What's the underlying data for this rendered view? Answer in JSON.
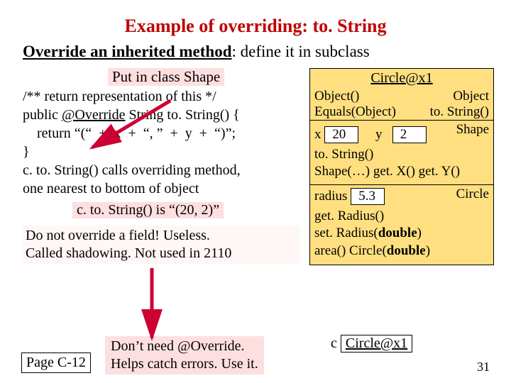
{
  "title": "Example of overriding: to. String",
  "subtitle_bold": "Override an inherited method",
  "subtitle_rest": ": define it in subclass",
  "putin": "Put in class Shape",
  "code": {
    "l1": "/** return representation of this */",
    "l2a": "public",
    "l2b": "@Override",
    "l2c": " String to. String() {",
    "l3": "    return “(“  +  x  +  “, ”  +  y  +  “)”;",
    "l4": "}",
    "l5": "c. to. String() calls overriding method,",
    "l6": "one nearest to bottom of object"
  },
  "result": "c. to. String()  is   “(20, 2)”",
  "shadow1": "Do not override a field! Useless.",
  "shadow2": "Called shadowing. Not used in 2110",
  "override1": "Don’t need @Override.",
  "override2": "Helps catch errors. Use it.",
  "page": "Page C-12",
  "slidenum": "31",
  "obj": {
    "header": "Circle@x1",
    "o1": "Object()",
    "o2": "Object",
    "o3": "Equals(Object)",
    "o4": "to. String()",
    "shape_label": "Shape",
    "x": "x",
    "xv": "20",
    "y": "y",
    "yv": "2",
    "s1": "to. String()",
    "s2": "Shape(…)  get. X()  get. Y()",
    "circle_label": "Circle",
    "r": "radius",
    "rv": "5.3",
    "c1": "get. Radius()",
    "c2": "set. Radius(",
    "cb2": "double",
    "c2e": ")",
    "c3": "area()  Circle(",
    "cb3": "double",
    "c3e": ")"
  },
  "c_label": "c",
  "c_val": "Circle@x1"
}
